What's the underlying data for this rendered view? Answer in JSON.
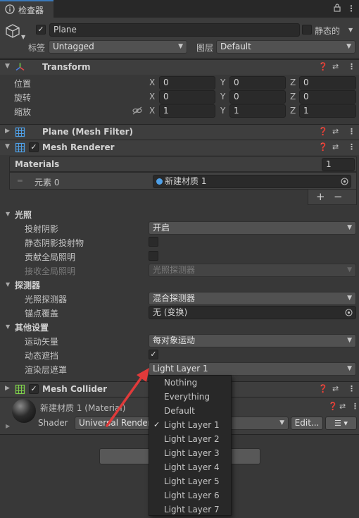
{
  "tab": {
    "title": "检查器"
  },
  "object": {
    "enabled_mark": "✓",
    "name": "Plane",
    "static_label": "静态的",
    "tag_label": "标签",
    "tag_value": "Untagged",
    "layer_label": "图层",
    "layer_value": "Default"
  },
  "transform": {
    "title": "Transform",
    "position_label": "位置",
    "rotation_label": "旋转",
    "scale_label": "缩放",
    "axis": {
      "x": "X",
      "y": "Y",
      "z": "Z"
    },
    "position": {
      "x": "0",
      "y": "0",
      "z": "0"
    },
    "rotation": {
      "x": "0",
      "y": "0",
      "z": "0"
    },
    "scale": {
      "x": "1",
      "y": "1",
      "z": "1"
    }
  },
  "mesh_filter": {
    "title": "Plane (Mesh Filter)"
  },
  "mesh_renderer": {
    "title": "Mesh Renderer",
    "materials_label": "Materials",
    "materials_count": "1",
    "element_label": "元素 0",
    "element_value": "新建材质 1",
    "add": "+",
    "remove": "−",
    "lighting_label": "光照",
    "cast_shadows_label": "投射阴影",
    "cast_shadows_value": "开启",
    "static_shadow_label": "静态阴影投射物",
    "contribute_gi_label": "贡献全局照明",
    "receive_gi_label": "接收全局照明",
    "receive_gi_value": "光照探测器",
    "probes_label": "探测器",
    "light_probes_label": "光照探测器",
    "light_probes_value": "混合探测器",
    "anchor_label": "锚点覆盖",
    "anchor_value": "无 (变换)",
    "other_label": "其他设置",
    "motion_vectors_label": "运动矢量",
    "motion_vectors_value": "每对象运动",
    "dynamic_occlusion_label": "动态遮挡",
    "dynamic_occlusion_mark": "✓",
    "rendering_layer_label": "渲染层遮罩",
    "rendering_layer_value": "Light Layer 1"
  },
  "mesh_collider": {
    "title": "Mesh Collider"
  },
  "material": {
    "title": "新建材质 1 (Material)",
    "shader_label": "Shader",
    "shader_value": "Universal Render P",
    "edit_label": "Edit..."
  },
  "dropdown_menu": {
    "items": [
      "Nothing",
      "Everything",
      "Default",
      "Light Layer 1",
      "Light Layer 2",
      "Light Layer 3",
      "Light Layer 4",
      "Light Layer 5",
      "Light Layer 6",
      "Light Layer 7"
    ],
    "checked_mark": "✓"
  },
  "colors": {
    "annotation_arrow": "#e03a3a",
    "tab_accent": "#3a79bb"
  }
}
